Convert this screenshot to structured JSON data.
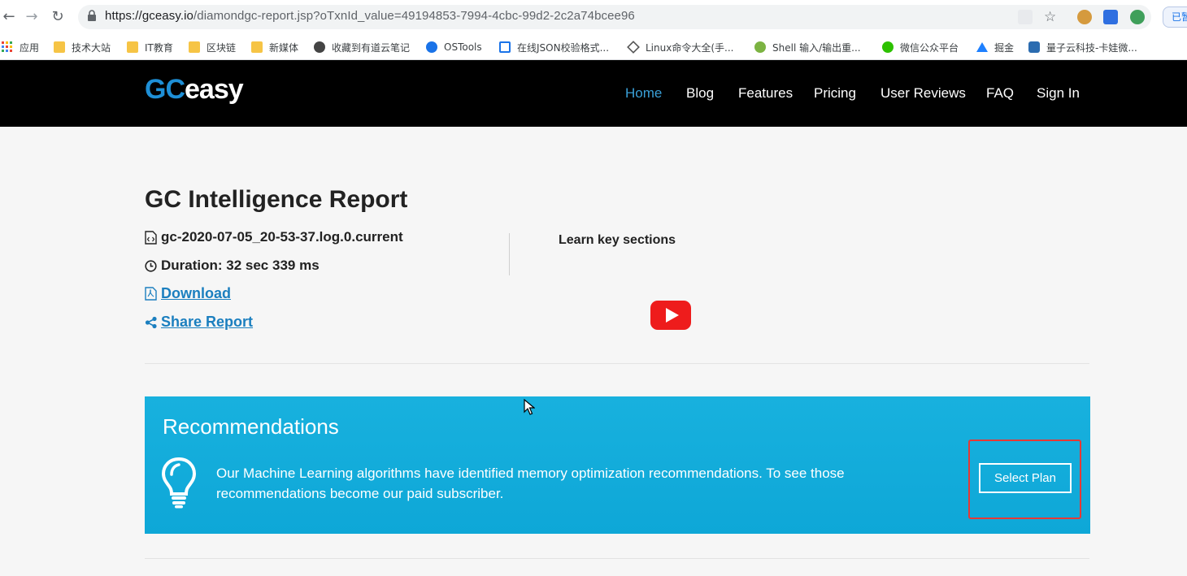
{
  "browser": {
    "url_host": "https://gceasy.io",
    "url_path": "/diamondgc-report.jsp?oTxnId_value=49194853-7994-4cbc-99d2-2c2a74bcee96",
    "corner_label": "已暂",
    "bookmarks": [
      {
        "label": "应用",
        "icon": "apps-grid-icon"
      },
      {
        "label": "技术大站",
        "icon": "folder-icon"
      },
      {
        "label": "IT教育",
        "icon": "folder-icon"
      },
      {
        "label": "区块链",
        "icon": "folder-icon"
      },
      {
        "label": "新媒体",
        "icon": "folder-icon"
      },
      {
        "label": "收藏到有道云笔记",
        "icon": "youdao-icon"
      },
      {
        "label": "OSTools",
        "icon": "ostools-icon"
      },
      {
        "label": "在线JSON校验格式...",
        "icon": "json-icon"
      },
      {
        "label": "Linux命令大全(手...",
        "icon": "linux-icon"
      },
      {
        "label": "Shell 输入/输出重...",
        "icon": "shell-icon"
      },
      {
        "label": "微信公众平台",
        "icon": "wechat-icon"
      },
      {
        "label": "掘金",
        "icon": "juejin-icon"
      },
      {
        "label": "量子云科技-卡娃微...",
        "icon": "cloud-icon"
      }
    ]
  },
  "site": {
    "logo_gc": "GC",
    "logo_easy": "easy",
    "menu": [
      "Home",
      "Blog",
      "Features",
      "Pricing",
      "User Reviews",
      "FAQ",
      "Sign In"
    ],
    "active_menu": "Home"
  },
  "report": {
    "title": "GC Intelligence Report",
    "file_name": "gc-2020-07-05_20-53-37.log.0.current",
    "duration": "Duration: 32 sec 339 ms",
    "download_label": "Download",
    "share_label": "Share Report",
    "learn_label": "Learn key sections"
  },
  "recommendations": {
    "title": "Recommendations",
    "text": "Our Machine Learning algorithms have identified memory optimization recommendations. To see those recommendations become our paid subscriber.",
    "button_label": "Select Plan"
  },
  "colors": {
    "accent_blue": "#1e8fd6",
    "banner": "#12abdb",
    "header_bg": "#000000",
    "link": "#1b7fbf",
    "highlight": "#e53935"
  }
}
